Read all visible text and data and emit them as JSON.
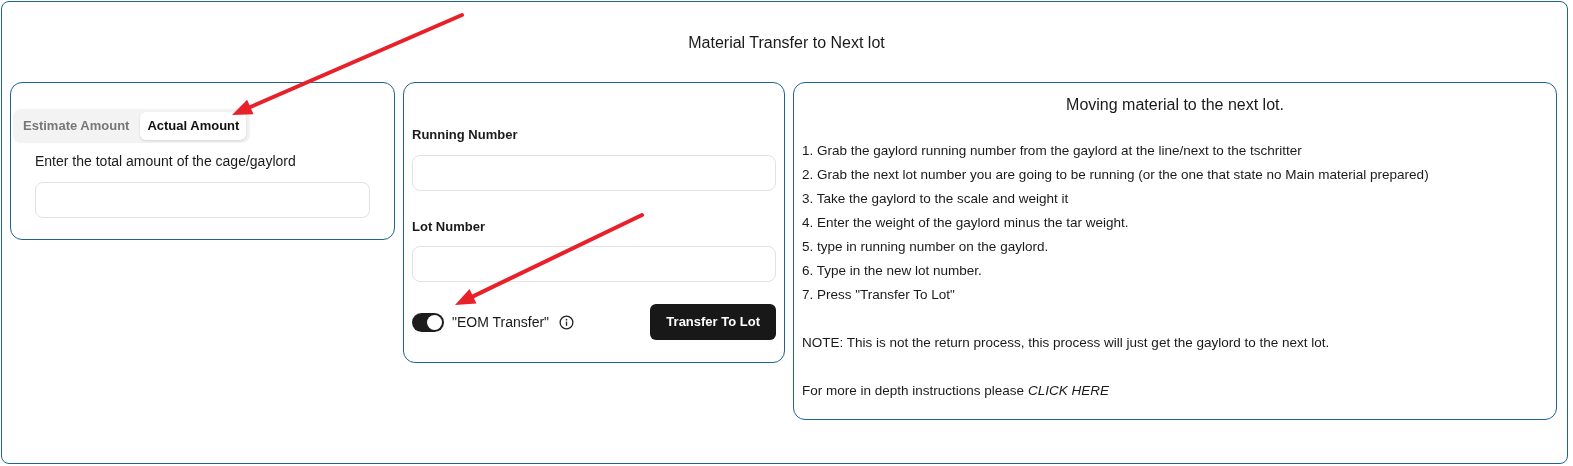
{
  "title": "Material Transfer to Next lot",
  "amount_panel": {
    "tabs": [
      {
        "label": "Estimate Amount",
        "selected": false
      },
      {
        "label": "Actual Amount",
        "selected": true
      }
    ],
    "prompt": "Enter the total amount of the cage/gaylord"
  },
  "transfer_panel": {
    "fields": [
      {
        "label": "Running Number"
      },
      {
        "label": "Lot Number"
      }
    ],
    "toggle": {
      "label": "\"EOM Transfer\"",
      "on": true
    },
    "button": "Transfer To Lot"
  },
  "instructions": {
    "heading": "Moving material to the next lot.",
    "steps": [
      "1. Grab the gaylord running number from the gaylord at the line/next to the tschritter",
      "2. Grab the next lot number you are going to be running (or the one that state no Main material prepared)",
      "3. Take the gaylord to the scale and weight it",
      "4. Enter the weight of the gaylord minus the tar weight.",
      "5. type in running number on the gaylord.",
      "6. Type in the new lot number.",
      "7. Press \"Transfer To Lot\""
    ],
    "note": "NOTE: This is not the return process, this process will just get the gaylord to the next lot.",
    "more_text": "For more in depth instructions please",
    "link": "CLICK HERE"
  },
  "annotation_arrows": [
    {
      "kind": "arrow"
    },
    {
      "kind": "arrow"
    }
  ]
}
